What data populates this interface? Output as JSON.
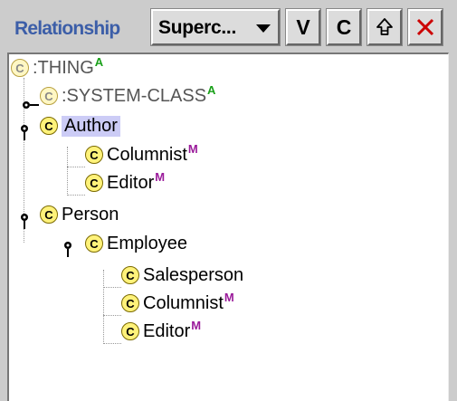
{
  "toolbar": {
    "label": "Relationship",
    "select_value": "Superc...",
    "buttons": {
      "v": "V",
      "c": "C",
      "up": "⇑",
      "x": "✕"
    },
    "icons": {
      "dropdown": "chevron-down-icon",
      "up": "up-arrow-icon",
      "x": "close-icon"
    }
  },
  "tree": {
    "class_icon_letter": "C",
    "nodes": [
      {
        "label": ":THING",
        "badge": "A"
      },
      {
        "label": ":SYSTEM-CLASS",
        "badge": "A"
      },
      {
        "label": "Author",
        "badge": ""
      },
      {
        "label": "Columnist",
        "badge": "M"
      },
      {
        "label": "Editor",
        "badge": "M"
      },
      {
        "label": "Person",
        "badge": ""
      },
      {
        "label": "Employee",
        "badge": ""
      },
      {
        "label": "Salesperson",
        "badge": ""
      },
      {
        "label": "Columnist",
        "badge": "M"
      },
      {
        "label": "Editor",
        "badge": "M"
      }
    ]
  },
  "colors": {
    "label_blue": "#3c5ea8",
    "selection": "#ccccf6",
    "badge_a": "#19a019",
    "badge_m": "#9a1a9a",
    "close_red": "#cc0000"
  }
}
